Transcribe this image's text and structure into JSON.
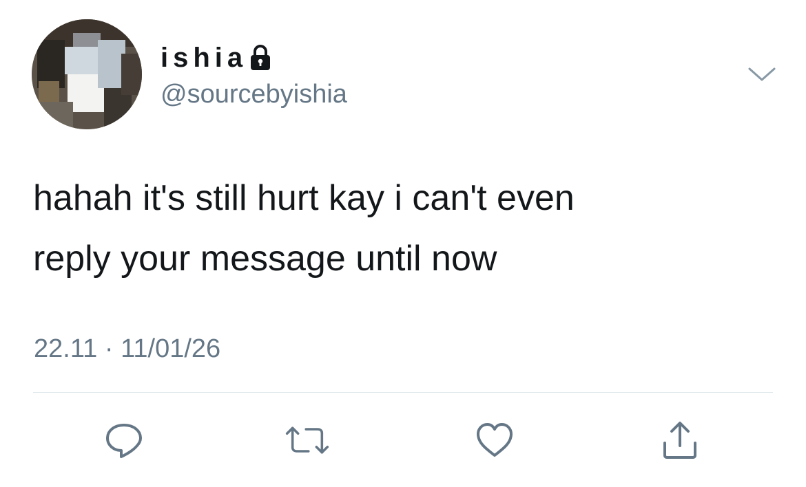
{
  "user": {
    "display_name": "ishia",
    "handle": "@sourcebyishia",
    "protected": true
  },
  "tweet": {
    "text": "hahah it's still hurt kay i can't even\nreply your message until now",
    "time": "22.11",
    "separator": "·",
    "date": "11/01/26"
  },
  "icons": {
    "lock": "lock-icon",
    "menu": "chevron-down-icon",
    "reply": "reply-icon",
    "retweet": "retweet-icon",
    "like": "heart-icon",
    "share": "share-icon"
  },
  "colors": {
    "text": "#14171a",
    "secondary": "#657786",
    "divider": "#e1e8ed",
    "icon": "#657786"
  }
}
